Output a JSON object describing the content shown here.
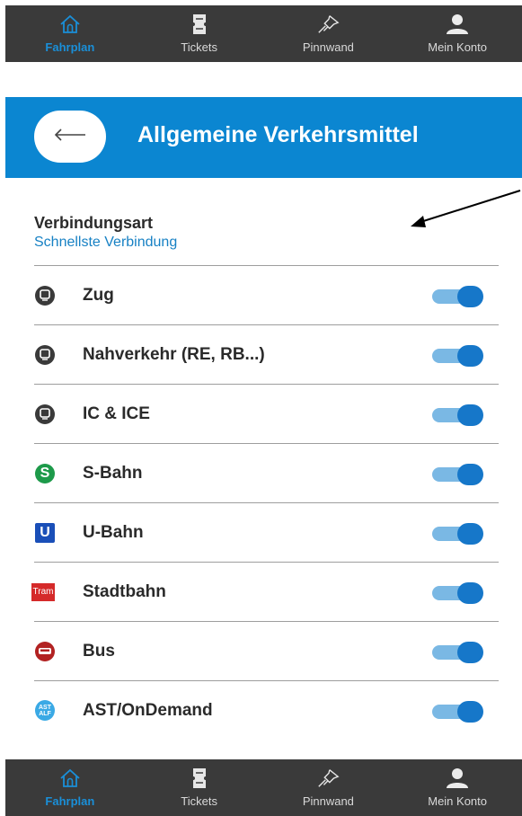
{
  "nav": {
    "items": [
      {
        "label": "Fahrplan",
        "icon": "home-icon",
        "active": true
      },
      {
        "label": "Tickets",
        "icon": "ticket-icon",
        "active": false
      },
      {
        "label": "Pinnwand",
        "icon": "pin-icon",
        "active": false
      },
      {
        "label": "Mein Konto",
        "icon": "user-icon",
        "active": false
      }
    ]
  },
  "header": {
    "back_icon": "arrow-left-icon",
    "title": "Allgemeine Verkehrsmittel"
  },
  "connection": {
    "title": "Verbindungsart",
    "value": "Schnellste Verbindung"
  },
  "transport": [
    {
      "label": "Zug",
      "icon": "train-icon",
      "enabled": true
    },
    {
      "label": "Nahverkehr (RE, RB...)",
      "icon": "train-icon",
      "enabled": true
    },
    {
      "label": "IC & ICE",
      "icon": "train-icon",
      "enabled": true
    },
    {
      "label": "S-Bahn",
      "icon": "s-bahn-icon",
      "enabled": true
    },
    {
      "label": "U-Bahn",
      "icon": "u-bahn-icon",
      "enabled": true
    },
    {
      "label": "Stadtbahn",
      "icon": "tram-icon",
      "enabled": true
    },
    {
      "label": "Bus",
      "icon": "bus-icon",
      "enabled": true
    },
    {
      "label": "AST/OnDemand",
      "icon": "ast-icon",
      "enabled": true
    }
  ],
  "icon_text": {
    "s": "S",
    "u": "U",
    "tram": "Tram",
    "ast_top": "AST",
    "ast_bottom": "ALF"
  },
  "colors": {
    "nav_bg": "#3a3a3a",
    "accent": "#1a8fd8",
    "header_bg": "#0b86d1",
    "toggle_on": "#1677c9"
  }
}
